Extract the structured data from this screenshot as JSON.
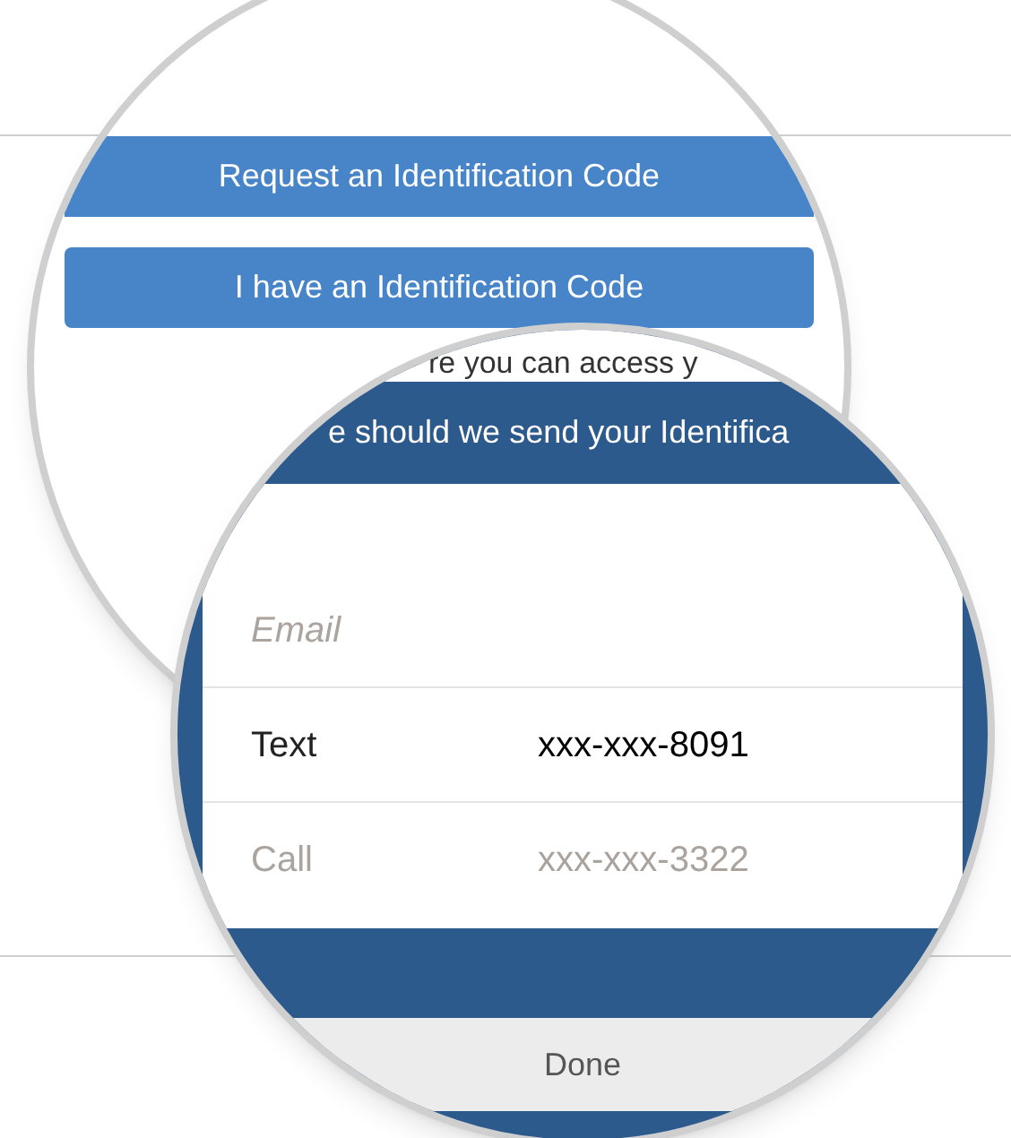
{
  "back_lens": {
    "buttons": [
      {
        "label": "Request an Identification Code"
      },
      {
        "label": "I have an Identification Code"
      }
    ]
  },
  "front_lens": {
    "intro_text": "re you can access y",
    "header": "e should we send your Identifica",
    "options": [
      {
        "label": "Email",
        "kind": "empty",
        "disabled": true
      },
      {
        "label": "Text",
        "kind": "number",
        "value": "xxx-xxx-8091",
        "disabled": false
      },
      {
        "label": "Call",
        "kind": "number",
        "value": "xxx-xxx-3322",
        "disabled": true
      }
    ],
    "done_button": "Done"
  }
}
